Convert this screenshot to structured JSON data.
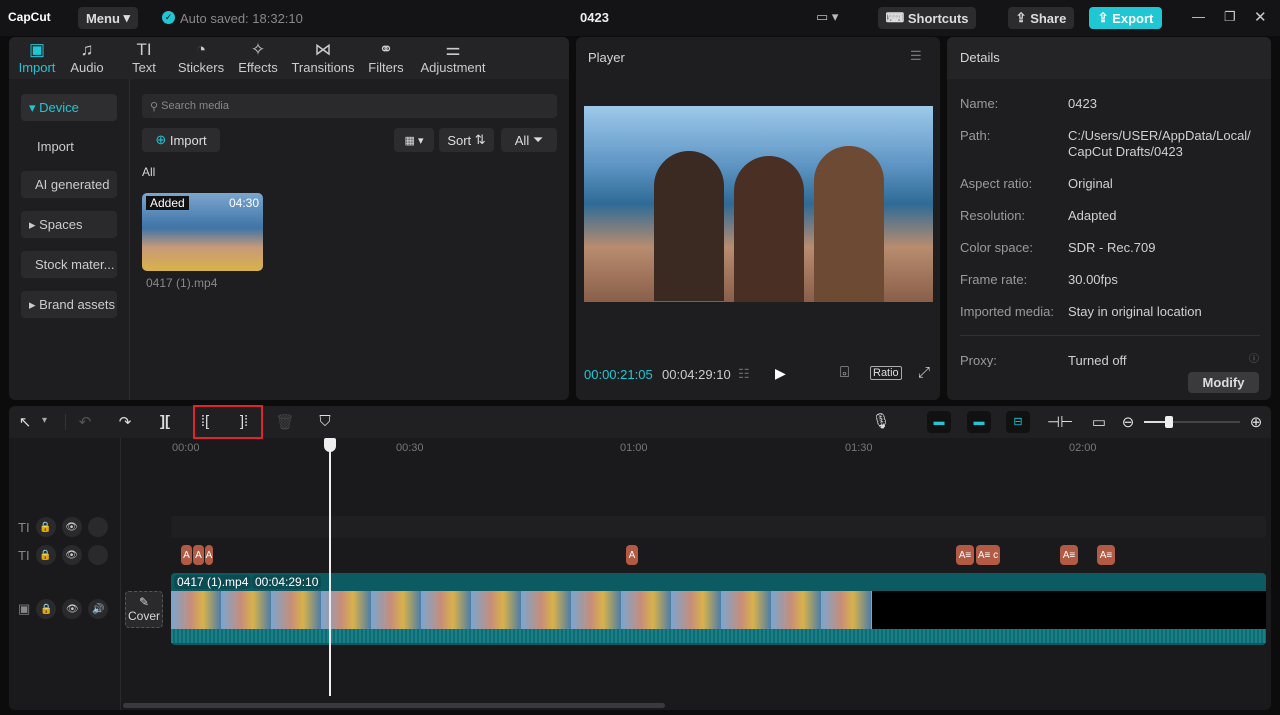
{
  "app": {
    "logo": "CapCut",
    "menu": "Menu",
    "autosave": "Auto saved: 18:32:10",
    "title": "0423",
    "shortcuts": "Shortcuts",
    "share": "Share",
    "export": "Export"
  },
  "tabs": [
    {
      "label": "Import",
      "icon": "import-icon"
    },
    {
      "label": "Audio",
      "icon": "audio-icon"
    },
    {
      "label": "Text",
      "icon": "text-icon"
    },
    {
      "label": "Stickers",
      "icon": "stickers-icon"
    },
    {
      "label": "Effects",
      "icon": "effects-icon"
    },
    {
      "label": "Transitions",
      "icon": "transitions-icon"
    },
    {
      "label": "Filters",
      "icon": "filters-icon"
    },
    {
      "label": "Adjustment",
      "icon": "adjustment-icon"
    }
  ],
  "sidebar": [
    "Device",
    "Import",
    "AI generated",
    "Spaces",
    "Stock mater...",
    "Brand assets"
  ],
  "media": {
    "search_placeholder": "Search media",
    "import": "Import",
    "sort": "Sort",
    "all": "All",
    "section": "All",
    "clip": {
      "badge": "Added",
      "duration": "04:30",
      "name": "0417 (1).mp4"
    }
  },
  "player": {
    "title": "Player",
    "current": "00:00:21:05",
    "total": "00:04:29:10",
    "ratio": "Ratio"
  },
  "details": {
    "title": "Details",
    "rows": [
      [
        "Name:",
        "0423"
      ],
      [
        "Path:",
        "C:/Users/USER/AppData/Local/ CapCut Drafts/0423"
      ],
      [
        "Aspect ratio:",
        "Original"
      ],
      [
        "Resolution:",
        "Adapted"
      ],
      [
        "Color space:",
        "SDR - Rec.709"
      ],
      [
        "Frame rate:",
        "30.00fps"
      ],
      [
        "Imported media:",
        "Stay in original location"
      ],
      [
        "Proxy:",
        "Turned off"
      ]
    ],
    "modify": "Modify"
  },
  "timeline": {
    "ticks": [
      "00:00",
      "00:30",
      "01:00",
      "01:30",
      "02:00"
    ],
    "clip_name": "0417 (1).mp4",
    "clip_duration": "00:04:29:10",
    "cover": "Cover",
    "zoom_level": 0.3,
    "playhead_time": "00:00:21:05"
  },
  "colors": {
    "accent": "#1fc7d4",
    "marker": "#b35a44",
    "clip": "#0d5b62"
  }
}
